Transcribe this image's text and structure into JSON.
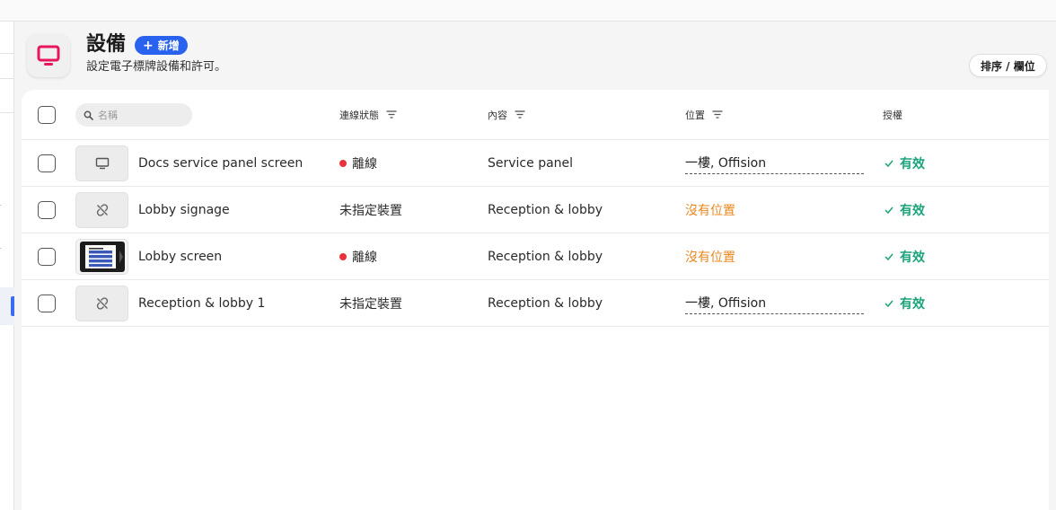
{
  "page": {
    "title": "設備",
    "add_label": "新增",
    "subtitle": "設定電子標牌設備和許可。",
    "sort_label": "排序 / 欄位",
    "accent_color": "#e8175d",
    "primary_color": "#2a62f0"
  },
  "table": {
    "search_placeholder": "名稱",
    "columns": {
      "status": "連線狀態",
      "content": "內容",
      "location": "位置",
      "license": "授權"
    },
    "rows": [
      {
        "name": "Docs service panel screen",
        "thumb": "monitor-icon",
        "status": "離線",
        "offline": true,
        "content": "Service panel",
        "location": "一樓, Offision",
        "location_missing": false,
        "license": "有效"
      },
      {
        "name": "Lobby signage",
        "thumb": "unlinked-icon",
        "status": "未指定裝置",
        "offline": false,
        "content": "Reception & lobby",
        "location": "沒有位置",
        "location_missing": true,
        "license": "有效"
      },
      {
        "name": "Lobby screen",
        "thumb": "tablet-preview",
        "status": "離線",
        "offline": true,
        "content": "Reception & lobby",
        "location": "沒有位置",
        "location_missing": true,
        "license": "有效"
      },
      {
        "name": "Reception & lobby 1",
        "thumb": "unlinked-icon",
        "status": "未指定裝置",
        "offline": false,
        "content": "Reception & lobby",
        "location": "一樓, Offision",
        "location_missing": false,
        "license": "有效"
      }
    ]
  }
}
